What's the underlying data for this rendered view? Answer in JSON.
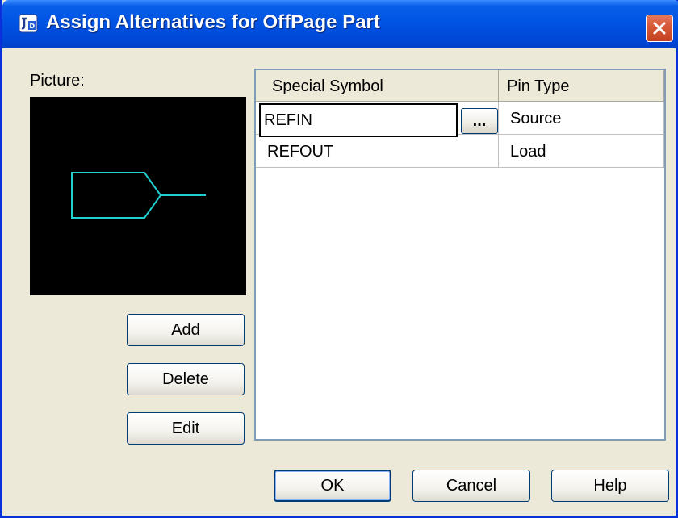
{
  "window": {
    "title": "Assign Alternatives for OffPage Part"
  },
  "picture": {
    "label": "Picture:",
    "stroke_color": "#20d0d0"
  },
  "left_buttons": {
    "add": "Add",
    "delete": "Delete",
    "edit": "Edit"
  },
  "grid": {
    "columns": [
      "Special Symbol",
      "Pin Type"
    ],
    "rows": [
      {
        "symbol": "REFIN",
        "pin_type": "Source"
      },
      {
        "symbol": "REFOUT",
        "pin_type": "Load"
      }
    ],
    "browse_label": "..."
  },
  "footer": {
    "ok": "OK",
    "cancel": "Cancel",
    "help": "Help"
  },
  "colors": {
    "titlebar": "#0054e3",
    "close": "#d85a3a",
    "dialog_bg": "#ece9d8"
  }
}
